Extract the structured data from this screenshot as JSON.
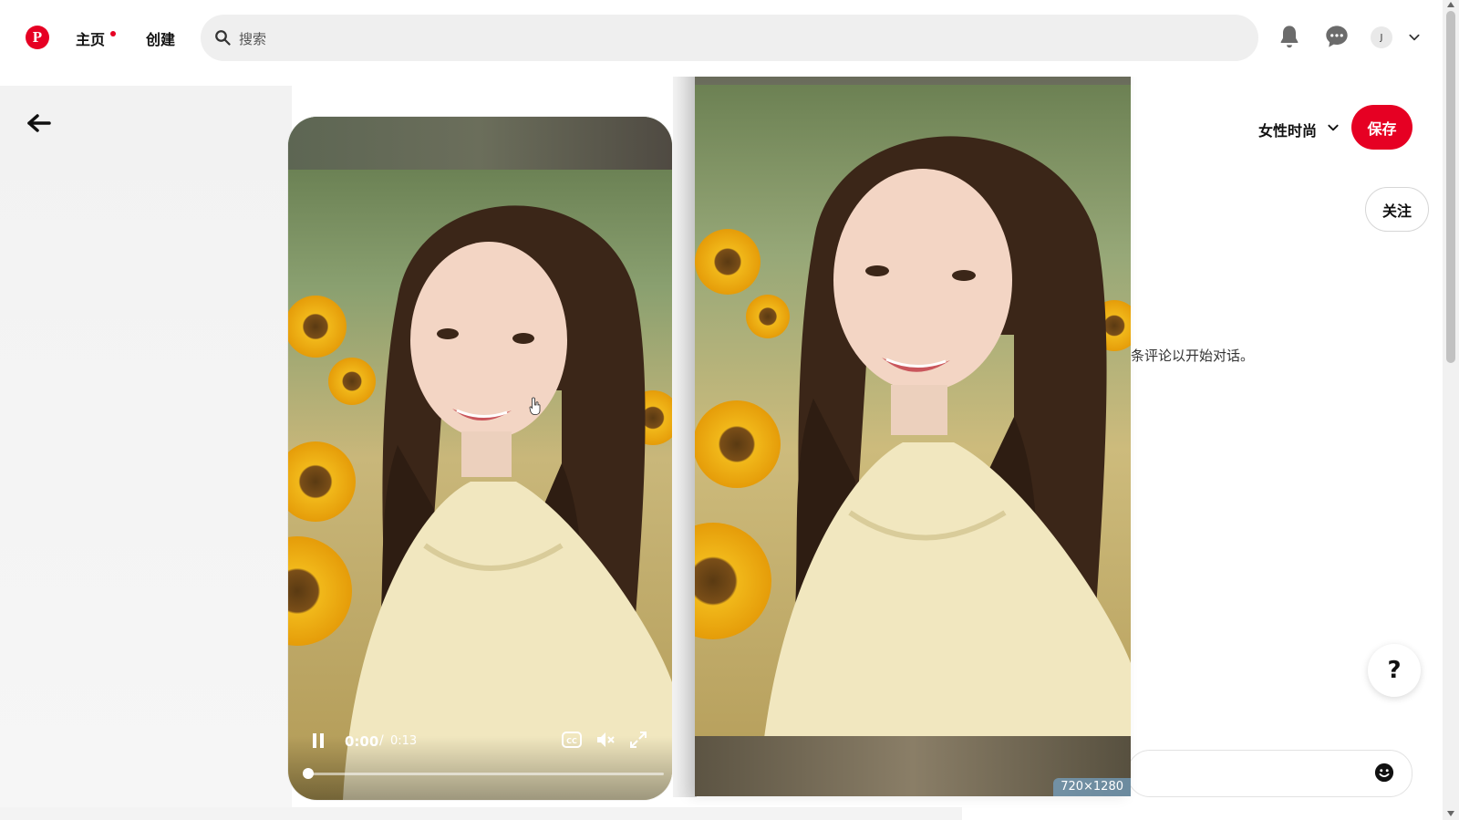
{
  "header": {
    "logo_letter": "P",
    "nav_home": "主页",
    "nav_create": "创建",
    "search_placeholder": "搜索",
    "avatar_initial": "J"
  },
  "video": {
    "time_current": "0:00",
    "time_separator": "/",
    "time_total": "0:13",
    "progress_fraction": 0.0
  },
  "preview": {
    "dimensions_badge": "720×1280"
  },
  "right_panel": {
    "board_name": "女性时尚",
    "save_label": "保存",
    "follow_label": "关注",
    "comment_hint": "条评论以开始对话。",
    "help_label": "?"
  },
  "colors": {
    "brand_red": "#e60023",
    "search_bg": "#efefef"
  },
  "icons": [
    "pinterest-logo",
    "search-icon",
    "bell-icon",
    "chat-icon",
    "chevron-down-icon",
    "back-arrow-icon",
    "pause-icon",
    "cc-icon",
    "mute-icon",
    "fullscreen-icon",
    "emoji-icon",
    "help-icon"
  ]
}
